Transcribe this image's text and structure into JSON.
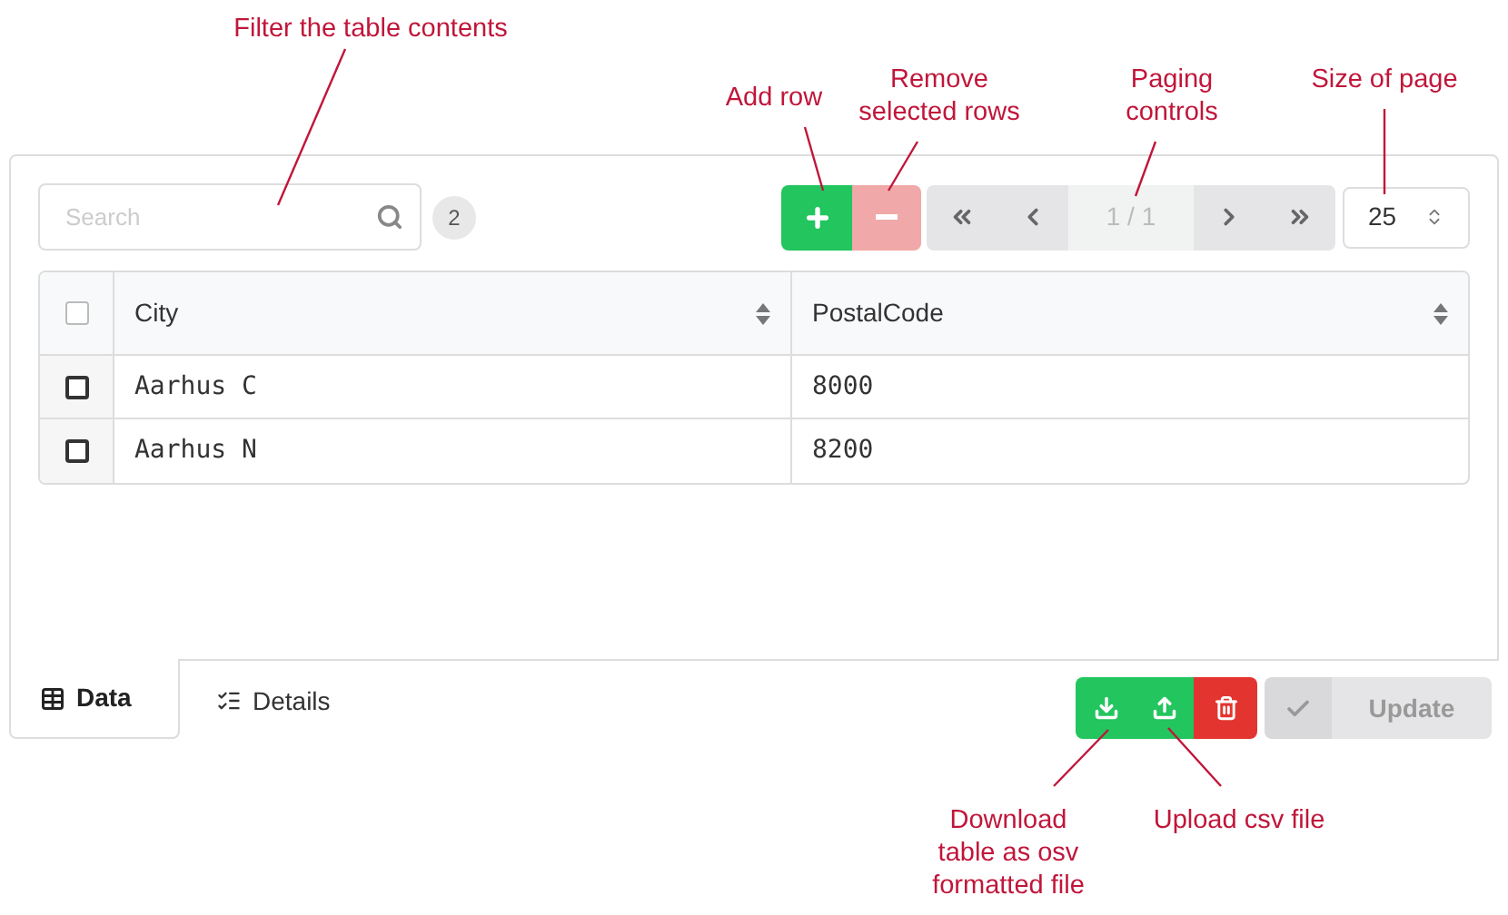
{
  "annotations": [
    {
      "text": "Filter the table contents"
    },
    {
      "text": "Add row"
    },
    {
      "text": "Remove selected rows"
    },
    {
      "text": "Paging controls"
    },
    {
      "text": "Size of page"
    },
    {
      "text": "Download table as osv formatted file"
    },
    {
      "text": "Upload csv file"
    }
  ],
  "search": {
    "placeholder": "Search"
  },
  "row_count": "2",
  "pager": {
    "page": "1 / 1",
    "page_size": "25"
  },
  "table": {
    "select_all_checked": false,
    "columns": [
      "City",
      "PostalCode"
    ],
    "rows": [
      {
        "checked": false,
        "cells": [
          "Aarhus C",
          "8000"
        ]
      },
      {
        "checked": false,
        "cells": [
          "Aarhus N",
          "8200"
        ]
      }
    ]
  },
  "tabs": [
    {
      "label": "Data",
      "selected": true,
      "kind": "table"
    },
    {
      "label": "Details",
      "selected": false,
      "kind": "list"
    }
  ],
  "update_button": {
    "label": "Update",
    "disabled": true
  }
}
